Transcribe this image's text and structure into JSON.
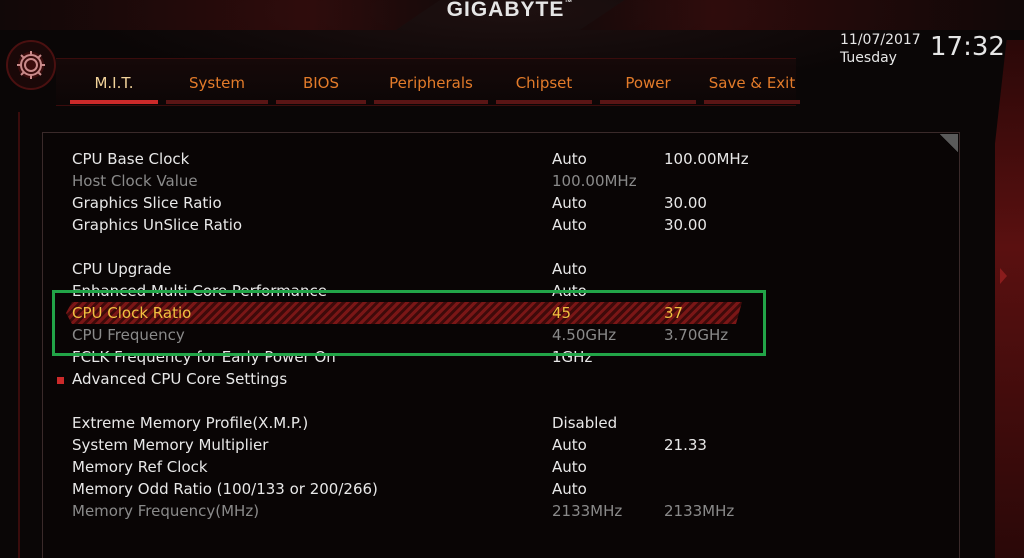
{
  "brand": "GIGABYTE",
  "datetime": {
    "date": "11/07/2017",
    "day": "Tuesday",
    "time": "17:32"
  },
  "tabs": [
    "M.I.T.",
    "System",
    "BIOS",
    "Peripherals",
    "Chipset",
    "Power",
    "Save & Exit"
  ],
  "active_tab": "M.I.T.",
  "settings": [
    {
      "label": "CPU Base Clock",
      "value": "Auto",
      "current": "100.00MHz"
    },
    {
      "label": "Host Clock Value",
      "value": "100.00MHz",
      "current": ""
    },
    {
      "label": "Graphics Slice Ratio",
      "value": "Auto",
      "current": "30.00"
    },
    {
      "label": "Graphics UnSlice Ratio",
      "value": "Auto",
      "current": "30.00"
    },
    {
      "label": "CPU Upgrade",
      "value": "Auto",
      "current": ""
    },
    {
      "label": "Enhanced Multi Core Performance",
      "value": "Auto",
      "current": ""
    },
    {
      "label": "CPU Clock Ratio",
      "value": "45",
      "current": "37"
    },
    {
      "label": "CPU Frequency",
      "value": "4.50GHz",
      "current": "3.70GHz"
    },
    {
      "label": "FCLK Frequency for Early Power On",
      "value": "1GHz",
      "current": ""
    },
    {
      "label": "Advanced CPU Core Settings",
      "value": "",
      "current": ""
    },
    {
      "label": "Extreme Memory Profile(X.M.P.)",
      "value": "Disabled",
      "current": ""
    },
    {
      "label": "System Memory Multiplier",
      "value": "Auto",
      "current": "21.33"
    },
    {
      "label": "Memory Ref Clock",
      "value": "Auto",
      "current": ""
    },
    {
      "label": "Memory Odd Ratio (100/133 or 200/266)",
      "value": "Auto",
      "current": ""
    },
    {
      "label": "Memory Frequency(MHz)",
      "value": "2133MHz",
      "current": "2133MHz"
    }
  ],
  "colors": {
    "accent_orange": "#e37b2a",
    "selected_text": "#f0c040",
    "highlight_red": "#7a1616",
    "annotation_green": "#22a548"
  }
}
